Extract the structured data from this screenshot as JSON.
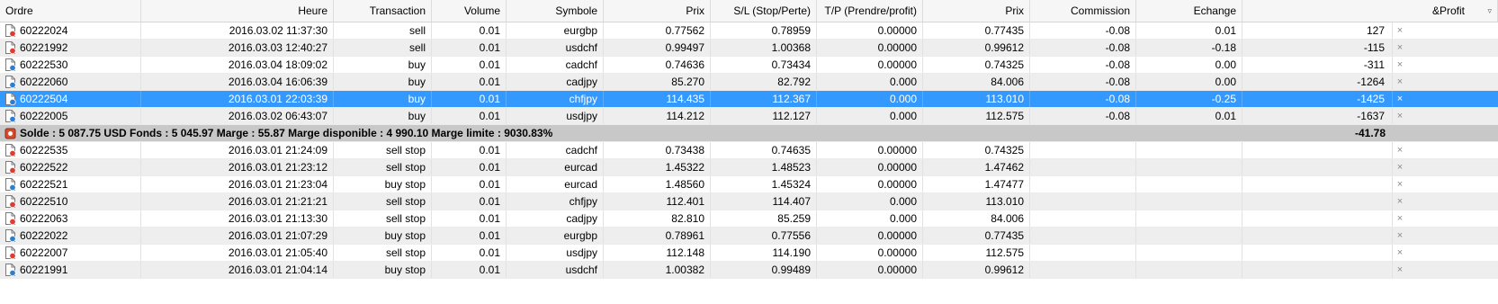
{
  "columns": [
    "Ordre",
    "Heure",
    "Transaction",
    "Volume",
    "Symbole",
    "Prix",
    "S/L (Stop/Perte)",
    "T/P (Prendre/profit)",
    "Prix",
    "Commission",
    "Echange",
    "&Profit"
  ],
  "sort_indicator": "▿",
  "close_glyph": "×",
  "rows": [
    {
      "order": "60222024",
      "time": "2016.03.02 11:37:30",
      "type": "sell",
      "volume": "0.01",
      "symbol": "eurgbp",
      "price": "0.77562",
      "sl": "0.78959",
      "tp": "0.00000",
      "cur": "0.77435",
      "commission": "-0.08",
      "swap": "0.01",
      "profit": "127",
      "kind": "sell"
    },
    {
      "order": "60221992",
      "time": "2016.03.03 12:40:27",
      "type": "sell",
      "volume": "0.01",
      "symbol": "usdchf",
      "price": "0.99497",
      "sl": "1.00368",
      "tp": "0.00000",
      "cur": "0.99612",
      "commission": "-0.08",
      "swap": "-0.18",
      "profit": "-115",
      "kind": "sell"
    },
    {
      "order": "60222530",
      "time": "2016.03.04 18:09:02",
      "type": "buy",
      "volume": "0.01",
      "symbol": "cadchf",
      "price": "0.74636",
      "sl": "0.73434",
      "tp": "0.00000",
      "cur": "0.74325",
      "commission": "-0.08",
      "swap": "0.00",
      "profit": "-311",
      "kind": "buy"
    },
    {
      "order": "60222060",
      "time": "2016.03.04 16:06:39",
      "type": "buy",
      "volume": "0.01",
      "symbol": "cadjpy",
      "price": "85.270",
      "sl": "82.792",
      "tp": "0.000",
      "cur": "84.006",
      "commission": "-0.08",
      "swap": "0.00",
      "profit": "-1264",
      "kind": "buy"
    },
    {
      "order": "60222504",
      "time": "2016.03.01 22:03:39",
      "type": "buy",
      "volume": "0.01",
      "symbol": "chfjpy",
      "price": "114.435",
      "sl": "112.367",
      "tp": "0.000",
      "cur": "113.010",
      "commission": "-0.08",
      "swap": "-0.25",
      "profit": "-1425",
      "kind": "buy",
      "selected": true
    },
    {
      "order": "60222005",
      "time": "2016.03.02 06:43:07",
      "type": "buy",
      "volume": "0.01",
      "symbol": "usdjpy",
      "price": "114.212",
      "sl": "112.127",
      "tp": "0.000",
      "cur": "112.575",
      "commission": "-0.08",
      "swap": "0.01",
      "profit": "-1637",
      "kind": "buy"
    }
  ],
  "summary": {
    "text": "Solde : 5 087.75 USD  Fonds : 5 045.97  Marge : 55.87  Marge disponible : 4 990.10  Marge limite : 9030.83%",
    "profit": "-41.78"
  },
  "pending": [
    {
      "order": "60222535",
      "time": "2016.03.01 21:24:09",
      "type": "sell stop",
      "volume": "0.01",
      "symbol": "cadchf",
      "price": "0.73438",
      "sl": "0.74635",
      "tp": "0.00000",
      "cur": "0.74325",
      "kind": "sell"
    },
    {
      "order": "60222522",
      "time": "2016.03.01 21:23:12",
      "type": "sell stop",
      "volume": "0.01",
      "symbol": "eurcad",
      "price": "1.45322",
      "sl": "1.48523",
      "tp": "0.00000",
      "cur": "1.47462",
      "kind": "sell"
    },
    {
      "order": "60222521",
      "time": "2016.03.01 21:23:04",
      "type": "buy stop",
      "volume": "0.01",
      "symbol": "eurcad",
      "price": "1.48560",
      "sl": "1.45324",
      "tp": "0.00000",
      "cur": "1.47477",
      "kind": "buy"
    },
    {
      "order": "60222510",
      "time": "2016.03.01 21:21:21",
      "type": "sell stop",
      "volume": "0.01",
      "symbol": "chfjpy",
      "price": "112.401",
      "sl": "114.407",
      "tp": "0.000",
      "cur": "113.010",
      "kind": "sell"
    },
    {
      "order": "60222063",
      "time": "2016.03.01 21:13:30",
      "type": "sell stop",
      "volume": "0.01",
      "symbol": "cadjpy",
      "price": "82.810",
      "sl": "85.259",
      "tp": "0.000",
      "cur": "84.006",
      "kind": "sell"
    },
    {
      "order": "60222022",
      "time": "2016.03.01 21:07:29",
      "type": "buy stop",
      "volume": "0.01",
      "symbol": "eurgbp",
      "price": "0.78961",
      "sl": "0.77556",
      "tp": "0.00000",
      "cur": "0.77435",
      "kind": "buy"
    },
    {
      "order": "60222007",
      "time": "2016.03.01 21:05:40",
      "type": "sell stop",
      "volume": "0.01",
      "symbol": "usdjpy",
      "price": "112.148",
      "sl": "114.190",
      "tp": "0.00000",
      "cur": "112.575",
      "kind": "sell"
    },
    {
      "order": "60221991",
      "time": "2016.03.01 21:04:14",
      "type": "buy stop",
      "volume": "0.01",
      "symbol": "usdchf",
      "price": "1.00382",
      "sl": "0.99489",
      "tp": "0.00000",
      "cur": "0.99612",
      "kind": "buy"
    }
  ],
  "icons": {
    "sell": "order-sell-icon",
    "buy": "order-buy-icon",
    "summary": "balance-icon"
  },
  "colors": {
    "selection": "#3399ff",
    "sell_dot": "#e03b2b",
    "buy_dot": "#2a7fd4",
    "summary_bg": "#c8c8c8"
  }
}
